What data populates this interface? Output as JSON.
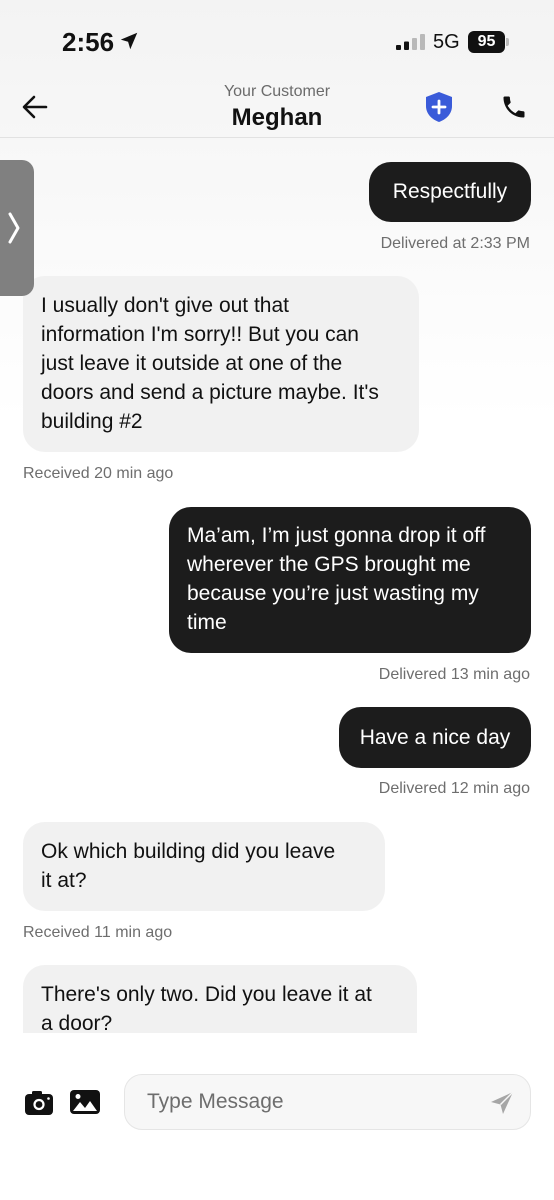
{
  "status_bar": {
    "time": "2:56",
    "network": "5G",
    "battery": "95",
    "icons": [
      "location-arrow-icon",
      "signal-bars-icon"
    ]
  },
  "header": {
    "subtitle": "Your Customer",
    "title": "Meghan",
    "icons": [
      "back-arrow-icon",
      "shield-plus-icon",
      "phone-icon"
    ]
  },
  "colors": {
    "outgoing_bubble": "#1c1c1c",
    "incoming_bubble": "#f1f1f1",
    "shield_blue": "#3a5bd9"
  },
  "messages": [
    {
      "direction": "out",
      "text": "Respectfully",
      "meta": "Delivered at 2:33 PM"
    },
    {
      "direction": "in",
      "lines": [
        "I usually don't give out that",
        "information I'm sorry!! But you can",
        "just leave it outside at one of the",
        "doors and send a picture maybe. It's",
        "building #2"
      ],
      "meta": "Received 20 min ago"
    },
    {
      "direction": "out",
      "lines": [
        "Ma’am, I’m just gonna drop it off",
        "wherever the GPS brought me",
        "because you’re just wasting my",
        "time"
      ],
      "meta": "Delivered 13 min ago"
    },
    {
      "direction": "out",
      "text": "Have a nice day",
      "meta": "Delivered 12 min ago"
    },
    {
      "direction": "in",
      "lines": [
        "Ok which building did you leave",
        "it at?"
      ],
      "meta": "Received 11 min ago"
    },
    {
      "direction": "in",
      "lines": [
        "There's only two. Did you leave it at",
        "a door?"
      ]
    }
  ],
  "composer": {
    "placeholder": "Type Message",
    "icons": [
      "camera-icon",
      "gallery-icon",
      "send-icon"
    ]
  }
}
